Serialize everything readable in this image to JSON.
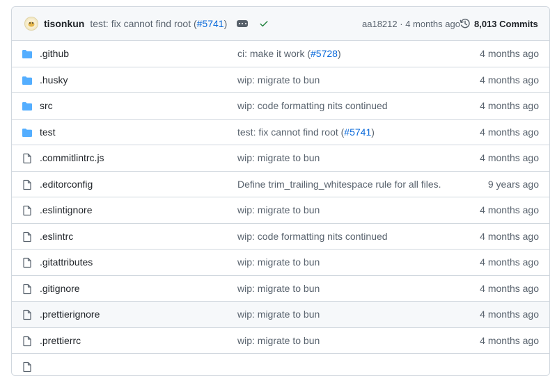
{
  "latest_commit": {
    "author": "tisonkun",
    "message_prefix": "test: fix cannot find root (",
    "message_link": "#5741",
    "message_suffix": ")",
    "hash": "aa18212",
    "separator": " · ",
    "age": "4 months ago",
    "commits_count": "8,013 Commits"
  },
  "files": [
    {
      "type": "folder",
      "name": ".github",
      "msg_prefix": "ci: make it work (",
      "msg_link": "#5728",
      "msg_suffix": ")",
      "age": "4 months ago"
    },
    {
      "type": "folder",
      "name": ".husky",
      "msg_prefix": "wip: migrate to bun",
      "msg_link": "",
      "msg_suffix": "",
      "age": "4 months ago"
    },
    {
      "type": "folder",
      "name": "src",
      "msg_prefix": "wip: code formatting nits continued",
      "msg_link": "",
      "msg_suffix": "",
      "age": "4 months ago"
    },
    {
      "type": "folder",
      "name": "test",
      "msg_prefix": "test: fix cannot find root (",
      "msg_link": "#5741",
      "msg_suffix": ")",
      "age": "4 months ago"
    },
    {
      "type": "file",
      "name": ".commitlintrc.js",
      "msg_prefix": "wip: migrate to bun",
      "msg_link": "",
      "msg_suffix": "",
      "age": "4 months ago"
    },
    {
      "type": "file",
      "name": ".editorconfig",
      "msg_prefix": "Define trim_trailing_whitespace rule for all files.",
      "msg_link": "",
      "msg_suffix": "",
      "age": "9 years ago"
    },
    {
      "type": "file",
      "name": ".eslintignore",
      "msg_prefix": "wip: migrate to bun",
      "msg_link": "",
      "msg_suffix": "",
      "age": "4 months ago"
    },
    {
      "type": "file",
      "name": ".eslintrc",
      "msg_prefix": "wip: code formatting nits continued",
      "msg_link": "",
      "msg_suffix": "",
      "age": "4 months ago"
    },
    {
      "type": "file",
      "name": ".gitattributes",
      "msg_prefix": "wip: migrate to bun",
      "msg_link": "",
      "msg_suffix": "",
      "age": "4 months ago"
    },
    {
      "type": "file",
      "name": ".gitignore",
      "msg_prefix": "wip: migrate to bun",
      "msg_link": "",
      "msg_suffix": "",
      "age": "4 months ago"
    },
    {
      "type": "file",
      "name": ".prettierignore",
      "msg_prefix": "wip: migrate to bun",
      "msg_link": "",
      "msg_suffix": "",
      "age": "4 months ago",
      "highlighted": true
    },
    {
      "type": "file",
      "name": ".prettierrc",
      "msg_prefix": "wip: migrate to bun",
      "msg_link": "",
      "msg_suffix": "",
      "age": "4 months ago"
    },
    {
      "type": "file",
      "name": "",
      "msg_prefix": "",
      "msg_link": "",
      "msg_suffix": "",
      "age": ""
    }
  ],
  "icons": {
    "folder": "folder-icon",
    "file": "file-icon",
    "history": "history-icon",
    "check": "check-icon",
    "ellipsis": "ellipsis-icon"
  },
  "colors": {
    "folder": "#54aeff",
    "link": "#0969da",
    "check": "#1a7f37",
    "muted": "#59636e",
    "border": "#d0d7de"
  }
}
